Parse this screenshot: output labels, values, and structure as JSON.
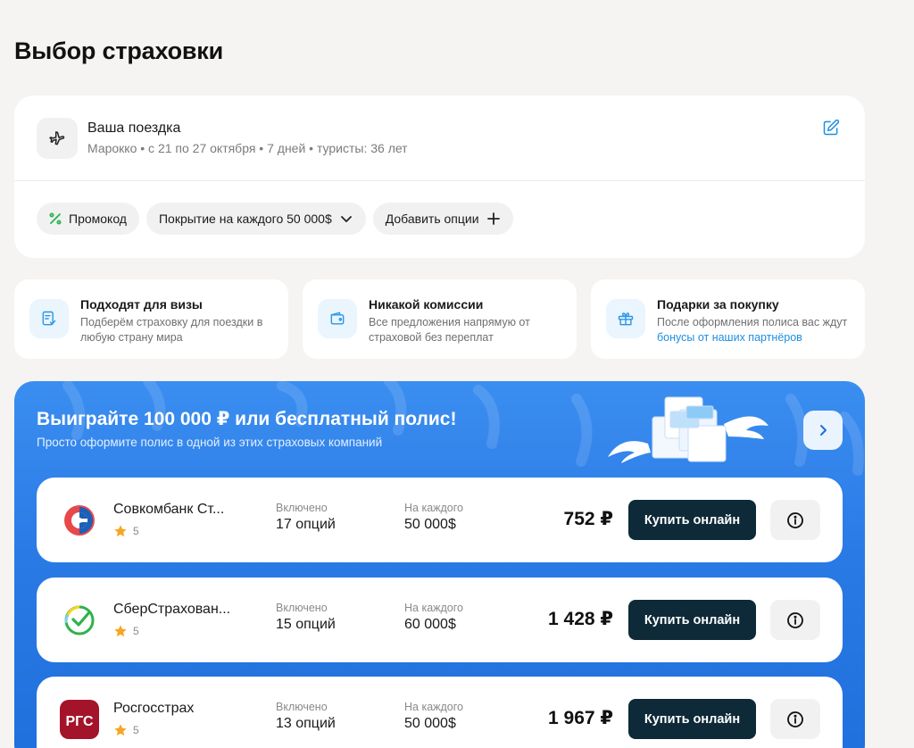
{
  "page": {
    "title": "Выбор страховки"
  },
  "trip": {
    "title": "Ваша поездка",
    "meta": "Марокко • с 21 по 27 октября • 7 дней • туристы: 36 лет",
    "icon": "plane-icon",
    "edit_icon": "edit-icon"
  },
  "chips": {
    "promo": "Промокод",
    "coverage": "Покрытие на каждого 50 000$",
    "options": "Добавить опции"
  },
  "features": [
    {
      "title": "Подходят для визы",
      "desc": "Подберём страховку для поездки в любую страну мира",
      "icon": "document-check-icon"
    },
    {
      "title": "Никакой комиссии",
      "desc": "Все предложения напрямую от страховой без переплат",
      "icon": "wallet-icon"
    },
    {
      "title": "Подарки за покупку",
      "desc": "После оформления полиса вас ждут",
      "link": "бонусы от наших партнёров",
      "icon": "gift-icon"
    }
  ],
  "promo": {
    "title": "Выиграйте 100 000 ₽ или бесплатный полис!",
    "subtitle": "Просто оформите полис в одной из этих страховых компаний"
  },
  "offers": [
    {
      "name": "Совкомбанк Ст...",
      "rating": "5",
      "included_label": "Включено",
      "included": "17 опций",
      "per_label": "На каждого",
      "per": "50 000$",
      "price": "752 ₽",
      "buy": "Купить онлайн"
    },
    {
      "name": "СберСтрахован...",
      "rating": "5",
      "included_label": "Включено",
      "included": "15 опций",
      "per_label": "На каждого",
      "per": "60 000$",
      "price": "1 428 ₽",
      "buy": "Купить онлайн"
    },
    {
      "name": "Росгосстрах",
      "rating": "5",
      "included_label": "Включено",
      "included": "13 опций",
      "per_label": "На каждого",
      "per": "50 000$",
      "price": "1 967 ₽",
      "buy": "Купить онлайн",
      "logo_text": "РГС"
    }
  ],
  "colors": {
    "accent": "#1e8fe0",
    "promo_bg": "#2a7ae6",
    "buy_bg": "#0e2a38",
    "star": "#f5a623"
  }
}
